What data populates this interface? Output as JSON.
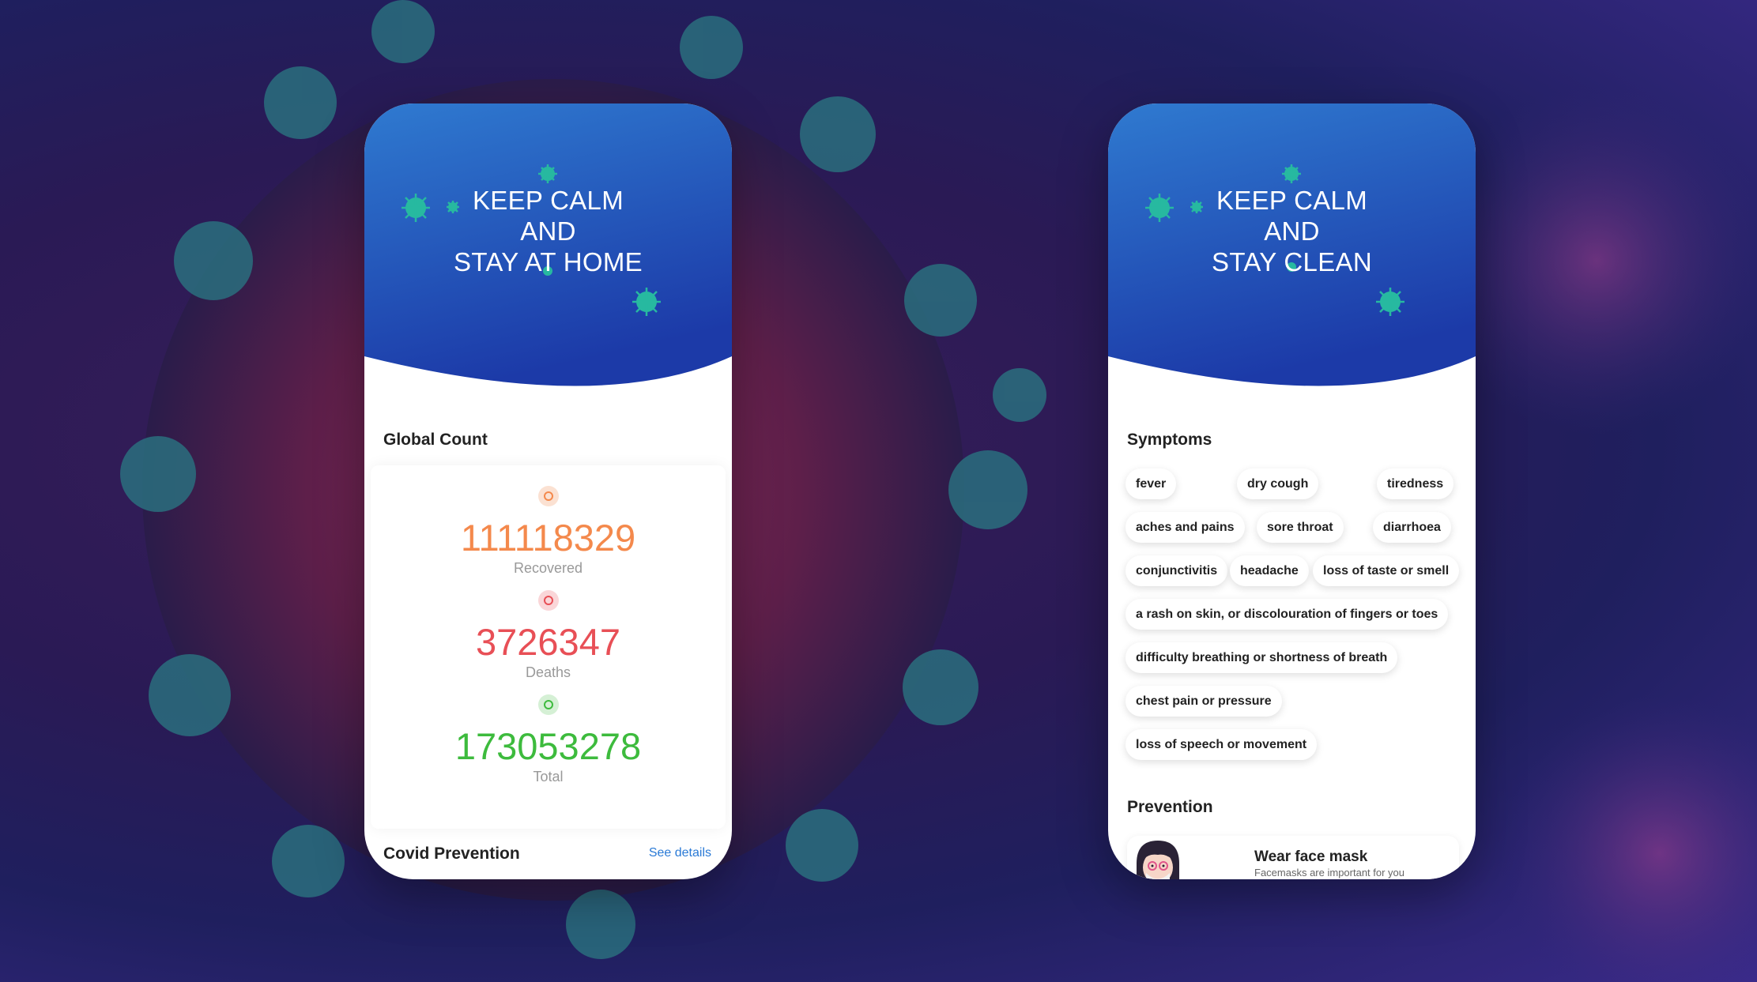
{
  "colors": {
    "header_top": "#2f7ad0",
    "header_bottom": "#1c3aa8",
    "virus_icon": "#27b9a0",
    "recovered": "#f4894c",
    "deaths": "#e84f56",
    "total": "#3dbb3d",
    "link": "#2a7ad6"
  },
  "left_phone": {
    "headline": [
      "KEEP CALM",
      "AND",
      "STAY AT HOME"
    ],
    "global_count_title": "Global Count",
    "stats": [
      {
        "value": "111118329",
        "label": "Recovered",
        "color": "#f4894c"
      },
      {
        "value": "3726347",
        "label": "Deaths",
        "color": "#e84f56"
      },
      {
        "value": "173053278",
        "label": "Total",
        "color": "#3dbb3d"
      }
    ],
    "prevention_title": "Covid Prevention",
    "see_details": "See details"
  },
  "right_phone": {
    "headline": [
      "KEEP CALM",
      "AND",
      "STAY CLEAN"
    ],
    "symptoms_title": "Symptoms",
    "symptoms": [
      "fever",
      "dry cough",
      "tiredness",
      "aches and pains",
      "sore throat",
      "diarrhoea",
      "conjunctivitis",
      "headache",
      "loss of taste or smell",
      "a rash on skin, or discolouration of fingers or toes",
      "difficulty breathing or shortness of breath",
      "chest pain or pressure",
      "loss of speech or movement"
    ],
    "prevention_title": "Prevention",
    "prevention_item": {
      "title": "Wear face mask",
      "subtitle": "Facemasks are important for you"
    }
  }
}
